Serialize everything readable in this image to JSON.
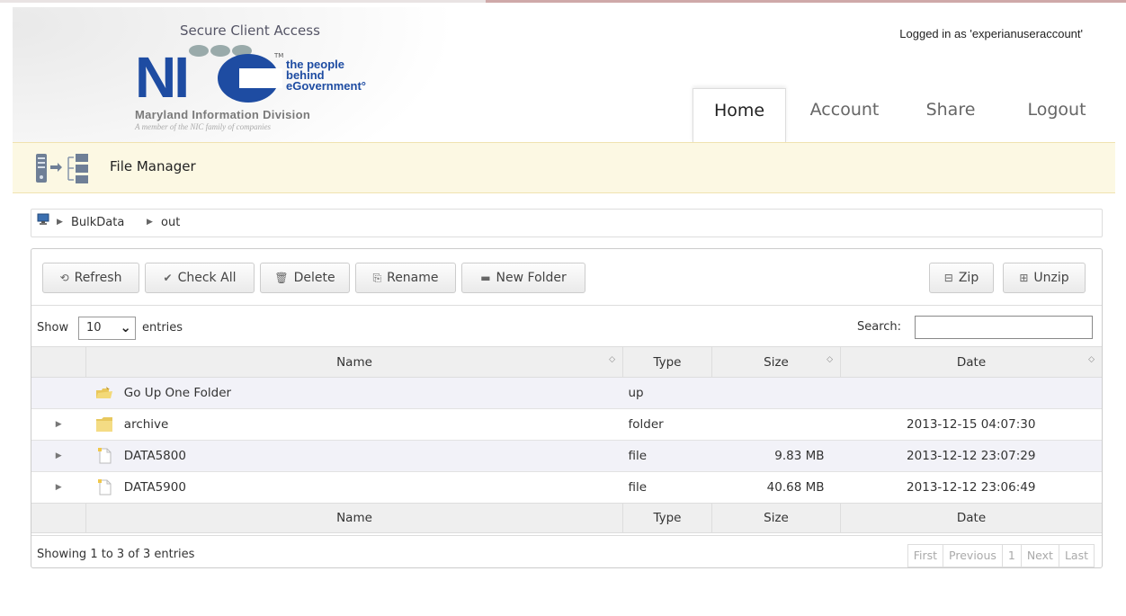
{
  "header": {
    "portal_title": "Secure Client Access",
    "logo": {
      "brand": "NIC",
      "tagline": "the people behind eGovernment",
      "division": "Maryland Information Division",
      "member_note": "A member of the NIC family of companies"
    },
    "logged_in": "Logged in as 'experianuseraccount'",
    "nav": [
      {
        "label": "Home",
        "active": true
      },
      {
        "label": "Account",
        "active": false
      },
      {
        "label": "Share",
        "active": false
      },
      {
        "label": "Logout",
        "active": false
      }
    ]
  },
  "titlebar": {
    "title": "File Manager",
    "icon": "file-tree-icon"
  },
  "breadcrumb": {
    "root_icon": "computer-icon",
    "items": [
      "BulkData",
      "out"
    ]
  },
  "toolbar": {
    "refresh": "Refresh",
    "check_all": "Check All",
    "delete": "Delete",
    "rename": "Rename",
    "new_folder": "New Folder",
    "zip": "Zip",
    "unzip": "Unzip"
  },
  "length": {
    "show": "Show",
    "value": "10",
    "entries": "entries"
  },
  "search": {
    "label": "Search:",
    "value": ""
  },
  "table": {
    "columns": [
      "Name",
      "Type",
      "Size",
      "Date"
    ],
    "rows": [
      {
        "icon": "folder-up-icon",
        "name": "Go Up One Folder",
        "type": "up",
        "size": "",
        "date": ""
      },
      {
        "icon": "folder-icon",
        "name": "archive",
        "type": "folder",
        "size": "",
        "date": "2013-12-15 04:07:30"
      },
      {
        "icon": "file-icon",
        "name": "DATA5800",
        "type": "file",
        "size": "9.83 MB",
        "date": "2013-12-12 23:07:29"
      },
      {
        "icon": "file-icon",
        "name": "DATA5900",
        "type": "file",
        "size": "40.68 MB",
        "date": "2013-12-12 23:06:49"
      }
    ]
  },
  "info": "Showing 1 to 3 of 3 entries",
  "pager": {
    "first": "First",
    "previous": "Previous",
    "page": "1",
    "next": "Next",
    "last": "Last"
  },
  "colors": {
    "accent": "#1e4ca2",
    "titlebar_bg": "#fcf8e3"
  }
}
